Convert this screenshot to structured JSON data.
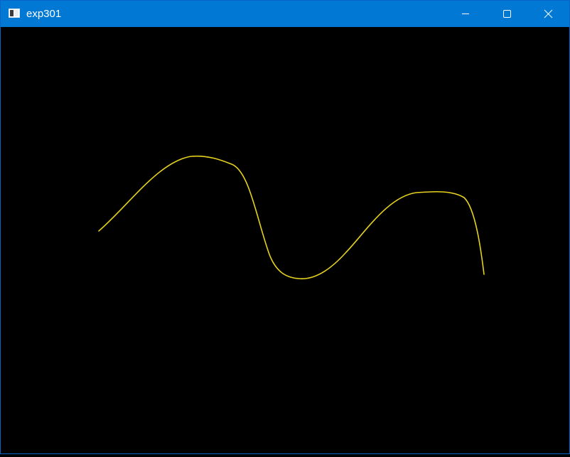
{
  "window": {
    "title": "exp301",
    "titlebar_color": "#0078d4",
    "background_color": "#000000",
    "controls": [
      "minimize-icon",
      "maximize-icon",
      "close-icon"
    ]
  },
  "canvas": {
    "curve_color": "#e6d21e"
  }
}
